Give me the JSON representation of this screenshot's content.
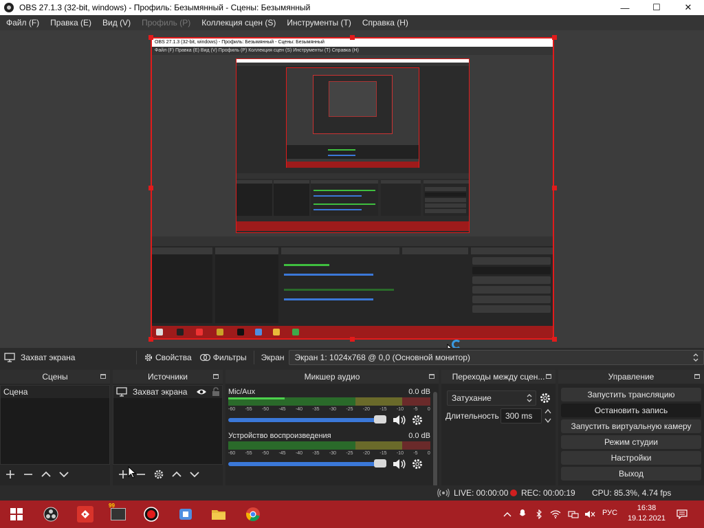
{
  "window": {
    "title": "OBS 27.1.3 (32-bit, windows) - Профиль: Безымянный - Сцены: Безымянный",
    "minimize": "—",
    "maximize": "☐",
    "close": "✕"
  },
  "menu": [
    {
      "label": "Файл (F)",
      "enabled": true
    },
    {
      "label": "Правка (E)",
      "enabled": true
    },
    {
      "label": "Вид (V)",
      "enabled": true
    },
    {
      "label": "Профиль (P)",
      "enabled": false
    },
    {
      "label": "Коллекция сцен (S)",
      "enabled": true
    },
    {
      "label": "Инструменты (T)",
      "enabled": true
    },
    {
      "label": "Справка (H)",
      "enabled": true
    }
  ],
  "preview": {
    "inner_title": "OBS 27.1.3 (32-bit, windows) - Профиль: Безымянный - Сцены: Безымянный",
    "inner_menu": "Файл (F)   Правка (E)   Вид (V)   Профиль (P)   Коллекция сцен (S)   Инструменты (T)   Справка (H)"
  },
  "source_toolbar": {
    "source_name": "Захват экрана",
    "properties_label": "Свойства",
    "filters_label": "Фильтры",
    "screen_label": "Экран",
    "screen_value": "Экран 1: 1024x768 @ 0,0 (Основной монитор)"
  },
  "scenes": {
    "title": "Сцены",
    "items": [
      "Сцена"
    ]
  },
  "sources": {
    "title": "Источники",
    "items": [
      {
        "label": "Захват экрана",
        "visible": true,
        "locked": false
      }
    ]
  },
  "mixer": {
    "title": "Микшер аудио",
    "scale": [
      "-60",
      "-55",
      "-50",
      "-45",
      "-40",
      "-35",
      "-30",
      "-25",
      "-20",
      "-15",
      "-10",
      "-5",
      "0"
    ],
    "channels": [
      {
        "name": "Mic/Aux",
        "db": "0.0 dB",
        "level": 0.28
      },
      {
        "name": "Устройство воспроизведения",
        "db": "0.0 dB",
        "level": 0.0
      }
    ]
  },
  "transitions": {
    "title": "Переходы между сцен...",
    "selected": "Затухание",
    "duration_label": "Длительность",
    "duration_value": "300 ms"
  },
  "controls": {
    "title": "Управление",
    "buttons": [
      {
        "label": "Запустить трансляцию",
        "active": false
      },
      {
        "label": "Остановить запись",
        "active": true
      },
      {
        "label": "Запустить виртуальную камеру",
        "active": false
      },
      {
        "label": "Режим студии",
        "active": false
      },
      {
        "label": "Настройки",
        "active": false
      },
      {
        "label": "Выход",
        "active": false
      }
    ]
  },
  "status": {
    "live": "LIVE: 00:00:00",
    "rec": "REC: 00:00:19",
    "cpu": "CPU: 85.3%, 4.74 fps"
  },
  "taskbar": {
    "badge": "99",
    "lang": "РУС",
    "time": "16:38",
    "date": "19.12.2021"
  },
  "colors": {
    "accent_red": "#e21b1b",
    "taskbar_red": "#a41f23",
    "fader_blue": "#3b78d8",
    "meter_green": "#4cd14c"
  }
}
